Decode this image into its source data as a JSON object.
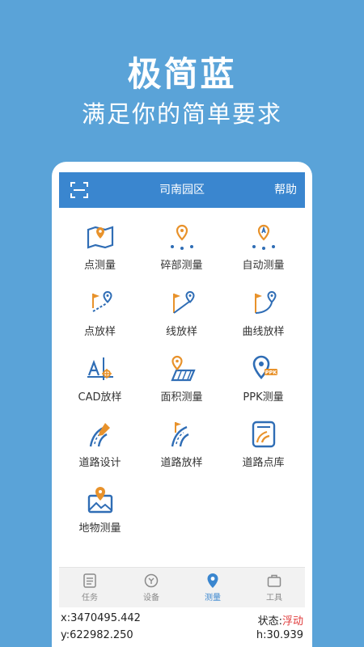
{
  "hero": {
    "title": "极简蓝",
    "subtitle": "满足你的简单要求"
  },
  "header": {
    "scan_icon": "scan-icon",
    "title": "司南园区",
    "help": "帮助"
  },
  "colors": {
    "background": "#5aa3d8",
    "header_blue": "#3a86cf",
    "icon_blue": "#2f6db5",
    "icon_orange": "#e8922b",
    "status_red": "#e03a3a"
  },
  "grid": [
    {
      "label": "点测量",
      "icon": "map-pin-icon"
    },
    {
      "label": "碎部测量",
      "icon": "detail-survey-icon"
    },
    {
      "label": "自动测量",
      "icon": "auto-survey-icon"
    },
    {
      "label": "点放样",
      "icon": "point-stakeout-icon"
    },
    {
      "label": "线放样",
      "icon": "line-stakeout-icon"
    },
    {
      "label": "曲线放样",
      "icon": "curve-stakeout-icon"
    },
    {
      "label": "CAD放样",
      "icon": "cad-stakeout-icon"
    },
    {
      "label": "面积测量",
      "icon": "area-survey-icon"
    },
    {
      "label": "PPK测量",
      "icon": "ppk-survey-icon"
    },
    {
      "label": "道路设计",
      "icon": "road-design-icon"
    },
    {
      "label": "道路放样",
      "icon": "road-stakeout-icon"
    },
    {
      "label": "道路点库",
      "icon": "road-point-library-icon"
    },
    {
      "label": "地物测量",
      "icon": "feature-survey-icon"
    }
  ],
  "nav": [
    {
      "label": "任务",
      "icon": "task-list-icon"
    },
    {
      "label": "设备",
      "icon": "device-icon"
    },
    {
      "label": "测量",
      "icon": "survey-pin-icon"
    },
    {
      "label": "工具",
      "icon": "toolbox-icon"
    }
  ],
  "status": {
    "x": "x:3470495.442",
    "y": "y:622982.250",
    "state_label": "状态:",
    "state_value": "浮动",
    "h": "h:30.939"
  }
}
